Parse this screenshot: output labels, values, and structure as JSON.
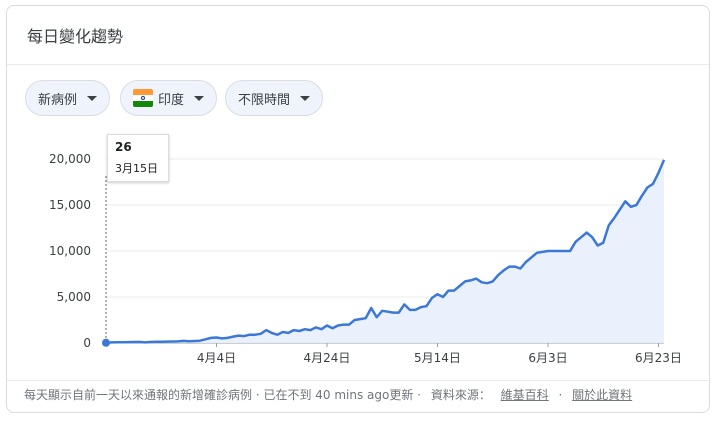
{
  "header": {
    "title": "每日變化趨勢"
  },
  "filters": [
    {
      "label": "新病例"
    },
    {
      "label": "印度",
      "icon": "india-flag-icon"
    },
    {
      "label": "不限時間"
    }
  ],
  "tooltip": {
    "value": "26",
    "date": "3月15日"
  },
  "footer": {
    "text": "每天顯示自前一天以來通報的新增確診病例 · 已在不到 40 mins ago更新 ·",
    "source_label": "資料來源：",
    "source_link": "維基百科",
    "about_link": "關於此資料"
  },
  "colors": {
    "line": "#3b78d8",
    "fill": "#e8f0fc",
    "accent": "#1a73e8"
  },
  "chart_data": {
    "type": "area",
    "xlabel": "",
    "ylabel": "",
    "ylim": [
      0,
      20000
    ],
    "ytick_labels": [
      "20,000",
      "15,000",
      "10,000",
      "5,000",
      "0"
    ],
    "ytick_values": [
      20000,
      15000,
      10000,
      5000,
      0
    ],
    "xtick_labels": [
      "4月4日",
      "4月24日",
      "5月14日",
      "6月3日",
      "6月23日"
    ],
    "xtick_day_index": [
      20,
      40,
      60,
      80,
      100
    ],
    "start_label": "3月15日",
    "series": [
      {
        "values": [
          26,
          60,
          80,
          90,
          100,
          110,
          120,
          70,
          110,
          130,
          140,
          150,
          160,
          170,
          230,
          180,
          220,
          250,
          400,
          550,
          600,
          500,
          550,
          700,
          800,
          750,
          900,
          900,
          1000,
          1400,
          1100,
          900,
          1200,
          1100,
          1400,
          1300,
          1500,
          1400,
          1700,
          1500,
          1900,
          1600,
          1900,
          2000,
          2000,
          2500,
          2600,
          2700,
          3800,
          2800,
          3500,
          3400,
          3300,
          3300,
          4200,
          3600,
          3600,
          3900,
          4000,
          4900,
          5300,
          5000,
          5700,
          5700,
          6200,
          6700,
          6800,
          7000,
          6600,
          6500,
          6700,
          7400,
          7900,
          8300,
          8300,
          8100,
          8800,
          9300,
          9800,
          9900,
          10000,
          10000,
          10000,
          10000,
          10000,
          11000,
          11500,
          12000,
          11500,
          10600,
          10900,
          12800,
          13600,
          14500,
          15400,
          14800,
          15000,
          16000,
          16900,
          17300,
          18500,
          19900
        ]
      }
    ]
  }
}
